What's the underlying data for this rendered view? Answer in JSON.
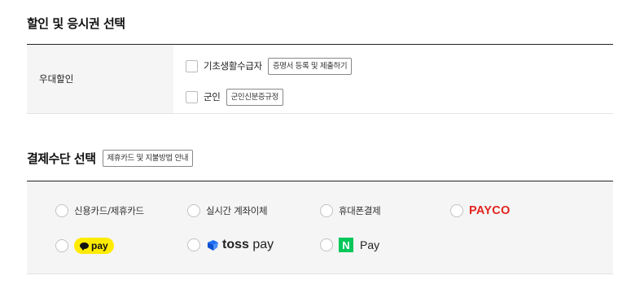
{
  "discount_section": {
    "title": "할인 및 응시권 선택",
    "row_label": "우대할인",
    "options": [
      {
        "label": "기초생활수급자",
        "button": "증명서 등록 및 제출하기"
      },
      {
        "label": "군인",
        "button": "군인신분증규정"
      }
    ]
  },
  "payment_section": {
    "title": "결제수단 선택",
    "guide_button": "제휴카드 및 지불방법 안내",
    "methods": {
      "card": "신용카드/제휴카드",
      "transfer": "실시간 계좌이체",
      "phone": "휴대폰결제",
      "payco": "PAYCO",
      "kakao": "pay",
      "toss_a": "toss",
      "toss_b": "pay",
      "naver_n": "N",
      "naver": "Pay"
    }
  },
  "colors": {
    "payco": "#e1241f",
    "kakao": "#ffeb00",
    "naver": "#03c75a",
    "toss": "#1e6ef4",
    "label_bg": "#f5f5f5"
  }
}
